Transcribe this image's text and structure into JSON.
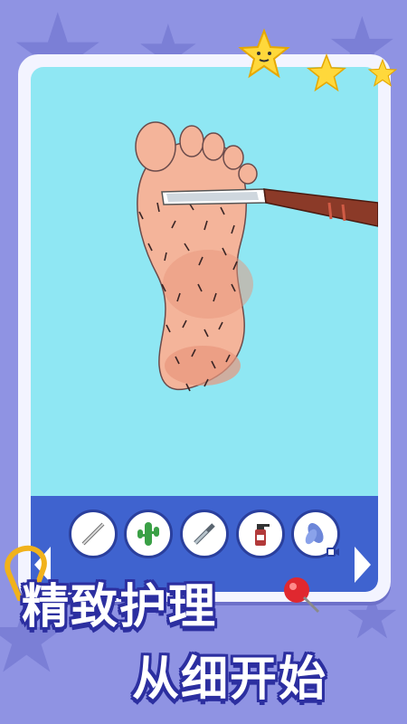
{
  "promo": {
    "line1": "精致护理",
    "line2": "从细开始"
  },
  "tools": [
    {
      "icon": "pencil-razor-icon"
    },
    {
      "icon": "cactus-icon"
    },
    {
      "icon": "scraper-icon"
    },
    {
      "icon": "spray-bottle-icon"
    },
    {
      "icon": "leaf-icon",
      "badge": "video-ad-icon"
    }
  ],
  "colors": {
    "background": "#8f93e3",
    "play_area": "#8fe7f3",
    "tray": "#3f63cf",
    "title_outline": "#2c2fa0"
  }
}
